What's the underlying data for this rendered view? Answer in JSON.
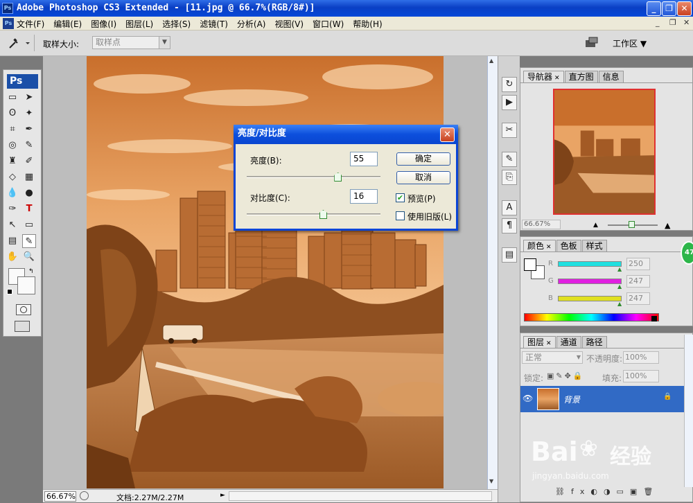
{
  "window": {
    "title": "Adobe Photoshop CS3 Extended - [11.jpg @ 66.7%(RGB/8#)]",
    "ps_badge": "Ps"
  },
  "menu": {
    "items": [
      "文件(F)",
      "编辑(E)",
      "图像(I)",
      "图层(L)",
      "选择(S)",
      "滤镜(T)",
      "分析(A)",
      "视图(V)",
      "窗口(W)",
      "帮助(H)"
    ],
    "mdi_buttons": [
      "_",
      "□",
      "×"
    ]
  },
  "options": {
    "sample_size_label": "取样大小:",
    "sample_size_value": "取样点",
    "workspace_label": "工作区 ▼"
  },
  "toolbox": {
    "header": "Ps"
  },
  "status": {
    "zoom": "66.67%",
    "doc_info": "文档:2.27M/2.27M"
  },
  "dialog": {
    "title": "亮度/对比度",
    "brightness_label": "亮度(B):",
    "brightness_value": "55",
    "brightness_fraction": 0.68,
    "contrast_label": "对比度(C):",
    "contrast_value": "16",
    "contrast_fraction": 0.57,
    "ok_label": "确定",
    "cancel_label": "取消",
    "preview_label": "预览(P)",
    "preview_checked": true,
    "legacy_label": "使用旧版(L)",
    "legacy_checked": false
  },
  "navigator": {
    "tabs": [
      "导航器",
      "直方图",
      "信息"
    ],
    "zoom": "66.67%"
  },
  "color_panel": {
    "tabs": [
      "颜色",
      "色板",
      "样式"
    ],
    "channels": [
      {
        "label": "R",
        "value": "250",
        "color": "#20e0e0"
      },
      {
        "label": "G",
        "value": "247",
        "color": "#e020e0"
      },
      {
        "label": "B",
        "value": "247",
        "color": "#e0e020"
      }
    ]
  },
  "layers_panel": {
    "tabs": [
      "图层",
      "通道",
      "路径"
    ],
    "blend_mode": "正常",
    "opacity_label": "不透明度:",
    "opacity_value": "100%",
    "lock_label": "锁定:",
    "fill_label": "填充:",
    "fill_value": "100%",
    "layer_name": "背景"
  },
  "watermark": {
    "brand": "Bai",
    "brand2": "经验",
    "url": "jingyan.baidu.com"
  },
  "colors": {
    "sepia_dark": "#8a4f1e",
    "sepia_light": "#f0b27a",
    "selection_blue": "#316ac5"
  },
  "side_badge": "47"
}
